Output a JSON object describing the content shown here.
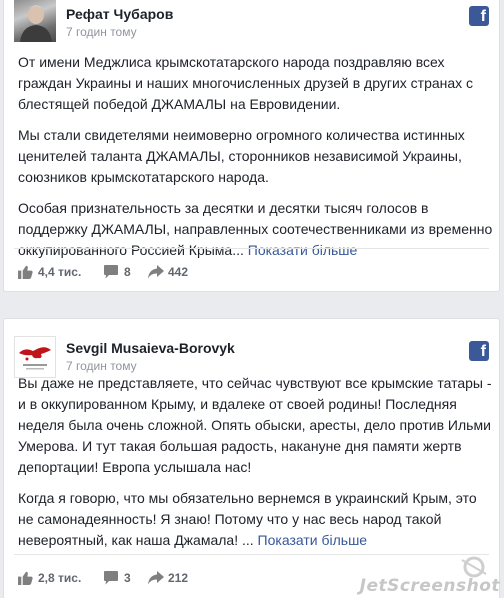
{
  "posts": [
    {
      "author": "Рефат Чубаров",
      "time": "7 годин тому",
      "paragraphs": [
        "От имени Меджлиса крымскотатарского народа поздравляю всех граждан Украины и наших многочисленных друзей в других странах с блестящей победой ДЖАМАЛЫ на Евровидении.",
        "Мы стали свидетелями неимоверно огромного количества истинных ценителей таланта ДЖАМАЛЫ, сторонников независимой Украины, союзников крымскотатарского народа."
      ],
      "last_paragraph": "Особая признательность за десятки и десятки тысяч голосов в поддержку ДЖАМАЛЫ, направленных соотечественниками из временно оккупированного Россией Крыма",
      "ellipsis": "... ",
      "more_link": "Показати більше",
      "likes": "4,4 тис.",
      "comments": "8",
      "shares": "442"
    },
    {
      "author": "Sevgil Musaieva-Borovyk",
      "time": "7 годин тому",
      "paragraphs": [
        "Вы даже не представляете, что сейчас чувствуют все крымские татары - и в оккупированном Крыму, и вдалеке от своей родины! Последняя неделя была очень сложной. Опять обыски, аресты, дело против Ильми Умерова. И тут такая большая радость, накануне дня памяти жертв депортации! Европа услышала нас!"
      ],
      "last_paragraph": "Когда я говорю, что мы обязательно вернемся в украинский Крым, это не самонадеянность! Я знаю! Потому что у нас весь народ такой невероятный, как наша Джамала!",
      "ellipsis": " ... ",
      "more_link": "Показати більше",
      "likes": "2,8 тис.",
      "comments": "3",
      "shares": "212"
    }
  ],
  "watermark": "JetScreenshot",
  "colors": {
    "facebook_blue": "#3b5998",
    "link": "#365899",
    "meta_gray": "#90949c",
    "background": "#e9ebee"
  },
  "icons": [
    "facebook-icon",
    "like-icon",
    "comment-icon",
    "share-icon"
  ]
}
